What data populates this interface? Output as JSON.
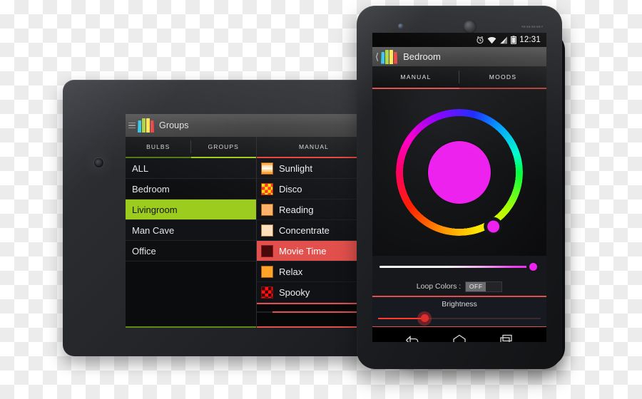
{
  "tablet": {
    "device_name": "android-tablet",
    "header": {
      "app_title": "Groups",
      "menu_icon": "hamburger-menu-icon",
      "logo_icon": "lamp-logo-icon"
    },
    "tabs": [
      {
        "label": "BULBS",
        "active": false,
        "underline_color": "#4e7a16"
      },
      {
        "label": "GROUPS",
        "active": true,
        "underline_color": "#9ccc1e"
      }
    ],
    "groups": [
      {
        "label": "ALL",
        "selected": false
      },
      {
        "label": "Bedroom",
        "selected": false
      },
      {
        "label": "Livingroom",
        "selected": true
      },
      {
        "label": "Man Cave",
        "selected": false
      },
      {
        "label": "Office",
        "selected": false
      }
    ],
    "right_tab": {
      "label": "MANUAL",
      "active": true,
      "underline_color": "#e2504d"
    },
    "moods": [
      {
        "label": "Sunlight",
        "swatch": "sw-sunlight",
        "selected": false
      },
      {
        "label": "Disco",
        "swatch": "sw-disco",
        "selected": false
      },
      {
        "label": "Reading",
        "swatch": "sw-reading",
        "selected": false
      },
      {
        "label": "Concentrate",
        "swatch": "sw-concentrate",
        "selected": false
      },
      {
        "label": "Movie Time",
        "swatch": "sw-movie",
        "selected": true
      },
      {
        "label": "Relax",
        "swatch": "sw-relax",
        "selected": false
      },
      {
        "label": "Spooky",
        "swatch": "sw-spooky",
        "selected": false
      }
    ],
    "navbar": [
      {
        "icon": "back-icon"
      },
      {
        "icon": "home-icon"
      }
    ]
  },
  "phone": {
    "device_name": "android-phone",
    "statusbar": {
      "alarm_icon": "alarm-clock-icon",
      "wifi_icon": "wifi-icon",
      "signal_icon": "signal-bars-icon",
      "battery_icon": "battery-icon",
      "time": "12:31"
    },
    "header": {
      "back_icon": "chevron-left-icon",
      "logo_icon": "lamp-logo-icon",
      "title": "Bedroom"
    },
    "tabs": [
      {
        "label": "MANUAL",
        "active": true,
        "underline_color": "#e2504d"
      },
      {
        "label": "MOODS",
        "active": false,
        "underline_color": "#e2504d"
      }
    ],
    "color_wheel": {
      "selected_color": "#ee22ee",
      "handle_angle_deg": 58,
      "ring_colors": [
        "#00ff40",
        "#b6ff00",
        "#ffe500",
        "#ff9000",
        "#ff1f00",
        "#ff0066",
        "#ff00c8",
        "#9000ff",
        "#1b2bff",
        "#00a2ff",
        "#00ffd0"
      ]
    },
    "saturation_slider": {
      "value_percent": 100,
      "handle_color": "#ee22ee"
    },
    "loop_colors": {
      "label": "Loop Colors :",
      "state": "OFF"
    },
    "brightness": {
      "label": "Brightness",
      "value_percent": 26,
      "accent_color": "#e02d2d"
    },
    "navbar": [
      {
        "icon": "back-icon"
      },
      {
        "icon": "home-icon"
      },
      {
        "icon": "recents-icon"
      }
    ]
  }
}
